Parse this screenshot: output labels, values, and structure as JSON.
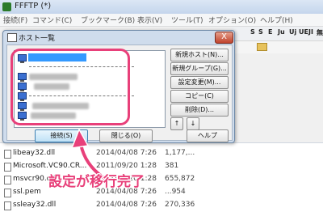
{
  "app": {
    "title": "FFFTP (*)"
  },
  "menu": [
    "接続(F)",
    "コマンド(C)",
    "ブックマーク(B)",
    "表示(V)",
    "ツール(T)",
    "オプション(O)",
    "ヘルプ(H)"
  ],
  "toolbar": [
    "S",
    "S",
    "E",
    "Ju",
    "Uj",
    "UE",
    "JI",
    "無"
  ],
  "dialog": {
    "title": "ホスト一覧",
    "close_label": "X",
    "buttons": {
      "new_host": "新規ホスト(N)...",
      "new_group": "新規グループ(G)...",
      "settings": "設定変更(M)...",
      "copy": "コピー(C)",
      "delete": "削除(D)...",
      "up": "↑",
      "down": "↓",
      "help": "ヘルプ",
      "connect": "接続(S)",
      "close": "閉じる(O)"
    }
  },
  "files": [
    {
      "name": "libeay32.dll",
      "date": "2014/04/08 7:26",
      "size": "1,177,..."
    },
    {
      "name": "Microsoft.VC90.CR...",
      "date": "2011/09/20 1:28",
      "size": "381"
    },
    {
      "name": "msvcr90.dll",
      "date": "2011/09/20 1:28",
      "size": "655,872"
    },
    {
      "name": "ssl.pem",
      "date": "2014/04/08 7:26",
      "size": "...954"
    },
    {
      "name": "ssleay32.dll",
      "date": "2014/04/08 7:26",
      "size": "270,336"
    }
  ],
  "annotation": {
    "text": "設定が移行完了",
    "color": "#e8407a"
  }
}
